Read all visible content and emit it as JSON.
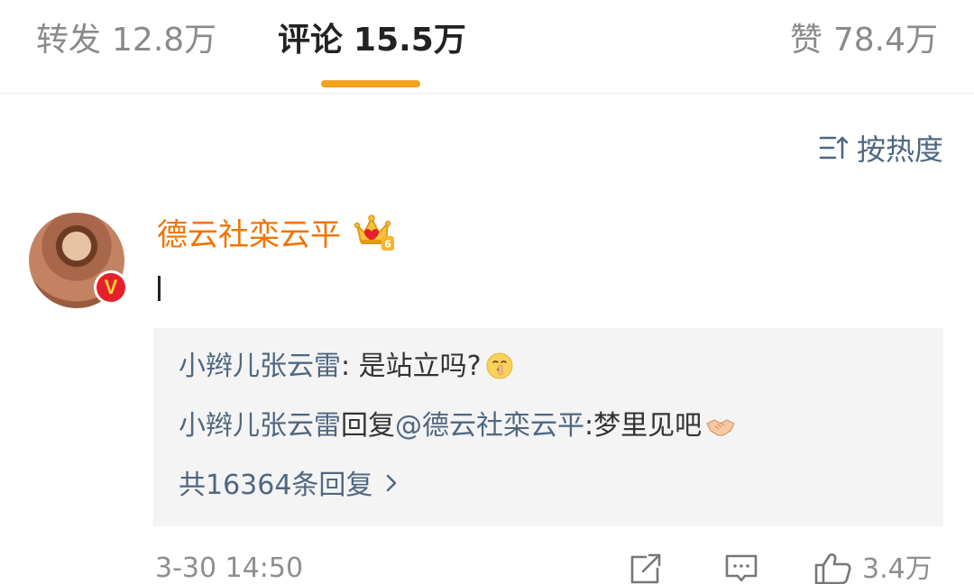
{
  "tabs": {
    "repost": {
      "label": "转发",
      "count": "12.8万"
    },
    "comment": {
      "label": "评论",
      "count": "15.5万",
      "active": true
    },
    "like": {
      "label": "赞",
      "count": "78.4万"
    }
  },
  "sort": {
    "label": "按热度",
    "icon": "sort-icon"
  },
  "comment": {
    "username": "德云社栾云平",
    "badge_icon": "verified-v-icon",
    "crown_icon": "member-crown-icon",
    "crown_level": "6",
    "text": "",
    "timestamp": "3-30 14:50",
    "like_count": "3.4万",
    "replies": [
      {
        "user": "小辫儿张云雷",
        "separator": ": ",
        "text": "是站立吗?",
        "emoji": "shush-face-emoji"
      },
      {
        "user": "小辫儿张云雷",
        "reply_word": "回复",
        "mention": "@德云社栾云平",
        "text": ":梦里见吧",
        "emoji": "handshake-emoji"
      }
    ],
    "more_replies": "共16364条回复",
    "more_replies_icon": "chevron-right-icon"
  },
  "colors": {
    "accent": "#f4a31d",
    "username": "#f07400",
    "link": "#4f6781",
    "muted": "#8e8e8e",
    "reply_bg": "#f4f4f4"
  }
}
